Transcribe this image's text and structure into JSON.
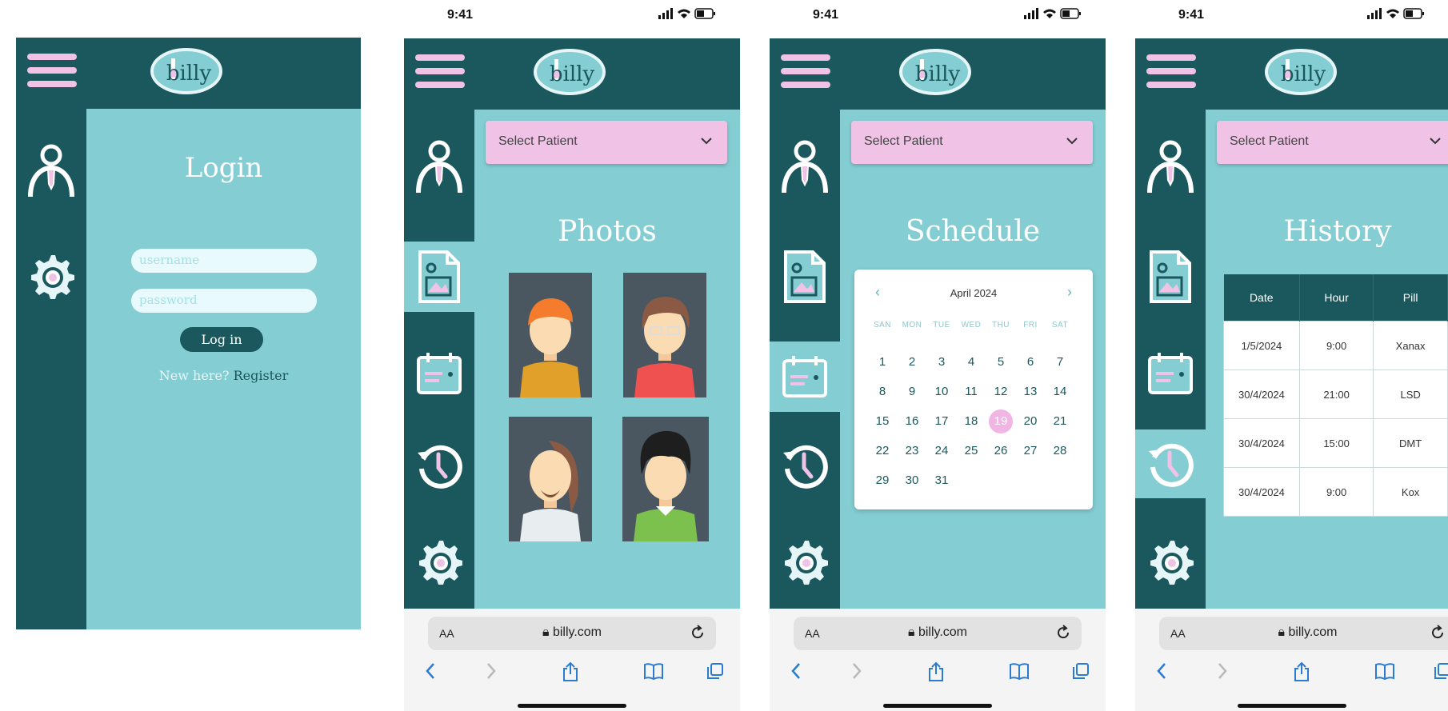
{
  "status_bar": {
    "time": "9:41"
  },
  "logo_text": "billy",
  "browser": {
    "aa": "AA",
    "url": "billy.com"
  },
  "login": {
    "title": "Login",
    "username_placeholder": "username",
    "password_placeholder": "password",
    "login_button": "Log in",
    "new_here": "New here?",
    "register": "Register"
  },
  "photos": {
    "select_patient": "Select Patient",
    "title": "Photos"
  },
  "schedule": {
    "select_patient": "Select Patient",
    "title": "Schedule",
    "calendar": {
      "month": "April 2024",
      "weekdays": [
        "SAN",
        "MON",
        "TUE",
        "WED",
        "THU",
        "FRI",
        "SAT"
      ],
      "days": [
        "1",
        "2",
        "3",
        "4",
        "5",
        "6",
        "7",
        "8",
        "9",
        "10",
        "11",
        "12",
        "13",
        "14",
        "15",
        "16",
        "17",
        "18",
        "19",
        "20",
        "21",
        "22",
        "23",
        "24",
        "25",
        "26",
        "27",
        "28",
        "29",
        "30",
        "31"
      ],
      "selected_day": "19"
    }
  },
  "history": {
    "select_patient": "Select Patient",
    "title": "History",
    "columns": [
      "Date",
      "Hour",
      "Pill"
    ],
    "rows": [
      [
        "1/5/2024",
        "9:00",
        "Xanax"
      ],
      [
        "30/4/2024",
        "21:00",
        "LSD"
      ],
      [
        "30/4/2024",
        "15:00",
        "DMT"
      ],
      [
        "30/4/2024",
        "9:00",
        "Kox"
      ]
    ]
  },
  "colors": {
    "dark_teal": "#1b585d",
    "light_teal": "#84cdd2",
    "pink": "#efc2e6",
    "white": "#ffffff"
  }
}
